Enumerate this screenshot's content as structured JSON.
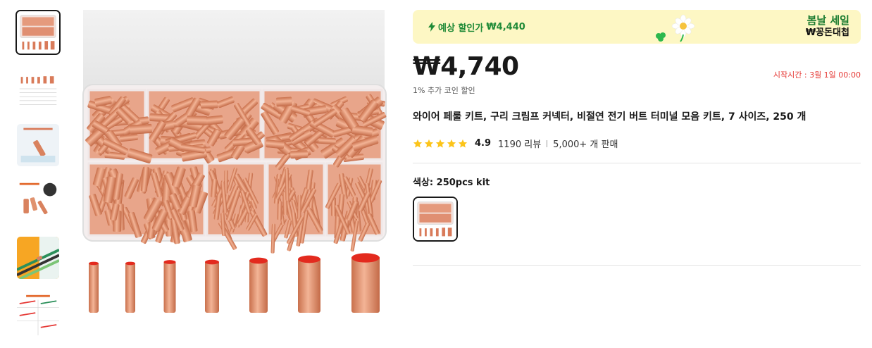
{
  "promo": {
    "label": "예상 할인가",
    "value": "₩4,440",
    "brand_line1": "봄날 세일",
    "brand_line2": "₩꽁돈대첩",
    "accent": "#1f8a37"
  },
  "price": {
    "current": "₩4,740",
    "start_time": "시작시간 :  3월 1일 00:00",
    "coin_discount": "1% 추가 코인 할인"
  },
  "product": {
    "title": "와이어 페룰 키트, 구리 크림프 커넥터, 비절연 전기 버트 터미널 모음 키트, 7 사이즈, 250 개",
    "rating": "4.9",
    "reviews": "1190 리뷰",
    "sold": "5,000+ 개 판매",
    "star_count": 5,
    "star_color": "#fcc419"
  },
  "options": {
    "color_label": "색상: 250pcs kit"
  },
  "thumbnails": [
    "kit-box",
    "size-chart",
    "product-intro",
    "copper-material",
    "cable-usage",
    "steps"
  ]
}
